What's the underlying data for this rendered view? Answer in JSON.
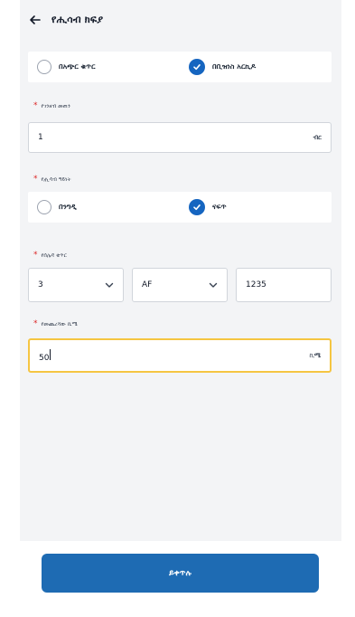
{
  "header": {
    "title": "የሒሳብ ክፍያ"
  },
  "payment_method": {
    "options": [
      {
        "label": "በአጭር ቁጥር",
        "selected": false
      },
      {
        "label": "በቢዝነስ አርኪዶ",
        "selected": true
      }
    ]
  },
  "fields": {
    "amount": {
      "label": "የገንዘብ መጠን",
      "value": "1",
      "suffix": "ብር"
    },
    "account_type": {
      "label": "የሒሳብ ዓይነት",
      "options": [
        {
          "label": "በንግዲ",
          "selected": false
        },
        {
          "label": "ናፍጥ",
          "selected": true
        }
      ]
    },
    "plate_number": {
      "label": "የሰሌዳ ቁጥር",
      "region": "3",
      "code": "AF",
      "number": "1235"
    },
    "liters": {
      "label": "የመጨረሻው ኪሜ",
      "value": "50",
      "suffix": "ኪሜ"
    }
  },
  "submit": {
    "label": "ይቀጥሉ"
  },
  "colors": {
    "primary": "#1e6bb3",
    "focus_border": "#f5c542",
    "required": "#dc2626",
    "background": "#f3f4f6"
  }
}
